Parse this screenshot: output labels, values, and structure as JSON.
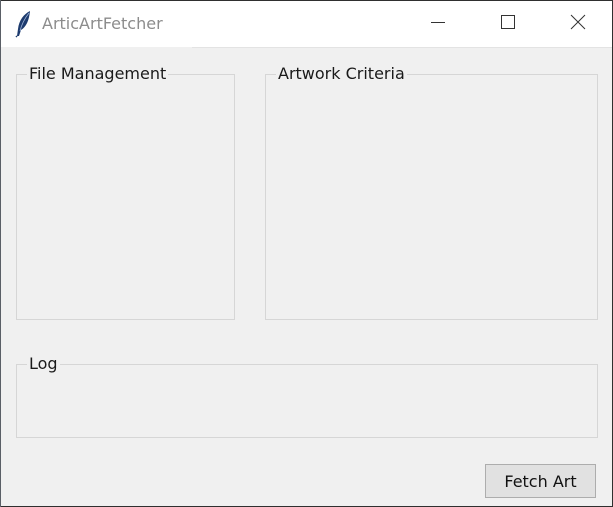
{
  "window": {
    "title": "ArticArtFetcher",
    "icon": "feather-icon",
    "controls": [
      "minimize-icon",
      "maximize-icon",
      "close-icon"
    ]
  },
  "groups": {
    "file_management": {
      "label": "File Management"
    },
    "artwork_criteria": {
      "label": "Artwork Criteria"
    },
    "log": {
      "label": "Log"
    }
  },
  "actions": {
    "fetch_label": "Fetch Art"
  },
  "colors": {
    "window_bg": "#f0f0f0",
    "titlebar_bg": "#ffffff",
    "title_text": "#8c8c8c",
    "group_border": "#d6d6d6",
    "button_bg": "#e1e1e1",
    "button_border": "#adadad"
  }
}
